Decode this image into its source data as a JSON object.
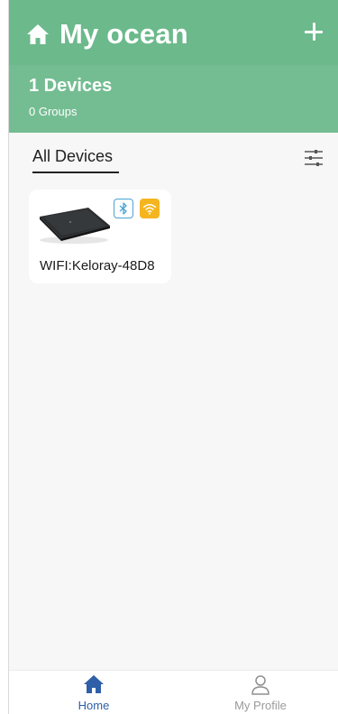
{
  "header": {
    "title": "My ocean",
    "home_icon": "home-icon",
    "add_icon": "plus-icon",
    "background_color": "#6cb98c"
  },
  "summary": {
    "devices_label": "1 Devices",
    "groups_label": "0 Groups"
  },
  "tabs": {
    "active_label": "All Devices",
    "filter_icon": "sliders-icon"
  },
  "devices": [
    {
      "name": "WIFI:Keloray-48D8",
      "image_icon": "device-router-image",
      "badges": [
        {
          "icon": "bluetooth-icon",
          "color": "#4aa3d8"
        },
        {
          "icon": "wifi-icon",
          "color": "#f5b51f"
        }
      ]
    }
  ],
  "bottom_nav": {
    "items": [
      {
        "label": "Home",
        "icon": "home-icon",
        "active": true,
        "color": "#2f5fa8"
      },
      {
        "label": "My Profile",
        "icon": "person-icon",
        "active": false,
        "color": "#9a9a9a"
      }
    ]
  }
}
